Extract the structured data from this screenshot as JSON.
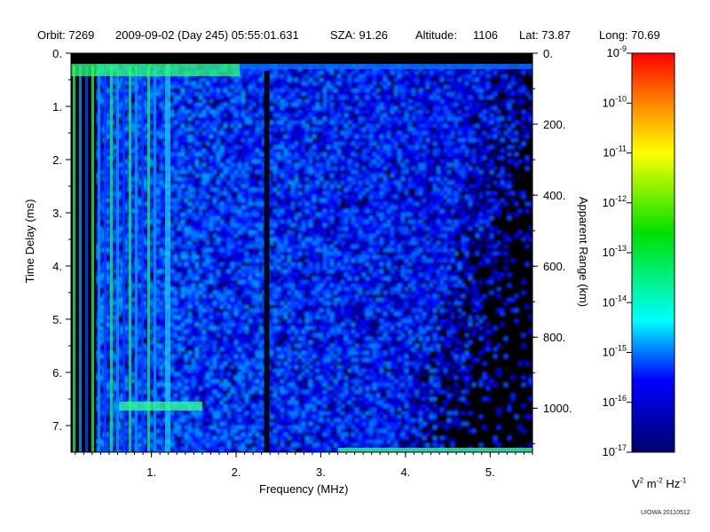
{
  "header": {
    "orbit": "Orbit: 7269",
    "datetime": "2009-09-02 (Day 245) 05:55:01.631",
    "sza": "SZA:  91.26",
    "altitude": "Altitude:     1106",
    "lat": "Lat:  73.87",
    "long": "Long:  70.69"
  },
  "footnote": "UIOWA 20110512",
  "chart_data": {
    "type": "heatmap",
    "xlabel": "Frequency (MHz)",
    "ylabel": "Time Delay (ms)",
    "y2label": "Apparent Range (km)",
    "x_ticks": [
      "1.",
      "2.",
      "3.",
      "4.",
      "5."
    ],
    "x_tick_values": [
      1,
      2,
      3,
      4,
      5
    ],
    "xlim": [
      0.05,
      5.5
    ],
    "y_ticks": [
      "0.",
      "1.",
      "2.",
      "3.",
      "4.",
      "5.",
      "6.",
      "7."
    ],
    "y_tick_values": [
      0,
      1,
      2,
      3,
      4,
      5,
      6,
      7
    ],
    "ylim": [
      0,
      7.5
    ],
    "y_inverted": true,
    "y2_ticks": [
      "0.",
      "200.",
      "400.",
      "600.",
      "800.",
      "1000."
    ],
    "y2_tick_values": [
      0,
      200,
      400,
      600,
      800,
      1000
    ],
    "y2lim": [
      0,
      1124
    ],
    "colorbar": {
      "ticks": [
        -9,
        -10,
        -11,
        -12,
        -13,
        -14,
        -15,
        -16,
        -17
      ],
      "range": [
        -17,
        -9
      ],
      "scale": "log",
      "unit_base": "V",
      "unit_exp1": "2",
      "unit_mid": " m",
      "unit_exp2": "-2",
      "unit_tail": " Hz",
      "unit_exp3": "-1",
      "colors": [
        "#000080",
        "#0000ff",
        "#00ffff",
        "#00ff00",
        "#ffff00",
        "#ff8000",
        "#ff0000"
      ]
    },
    "background_color": "#000000"
  }
}
